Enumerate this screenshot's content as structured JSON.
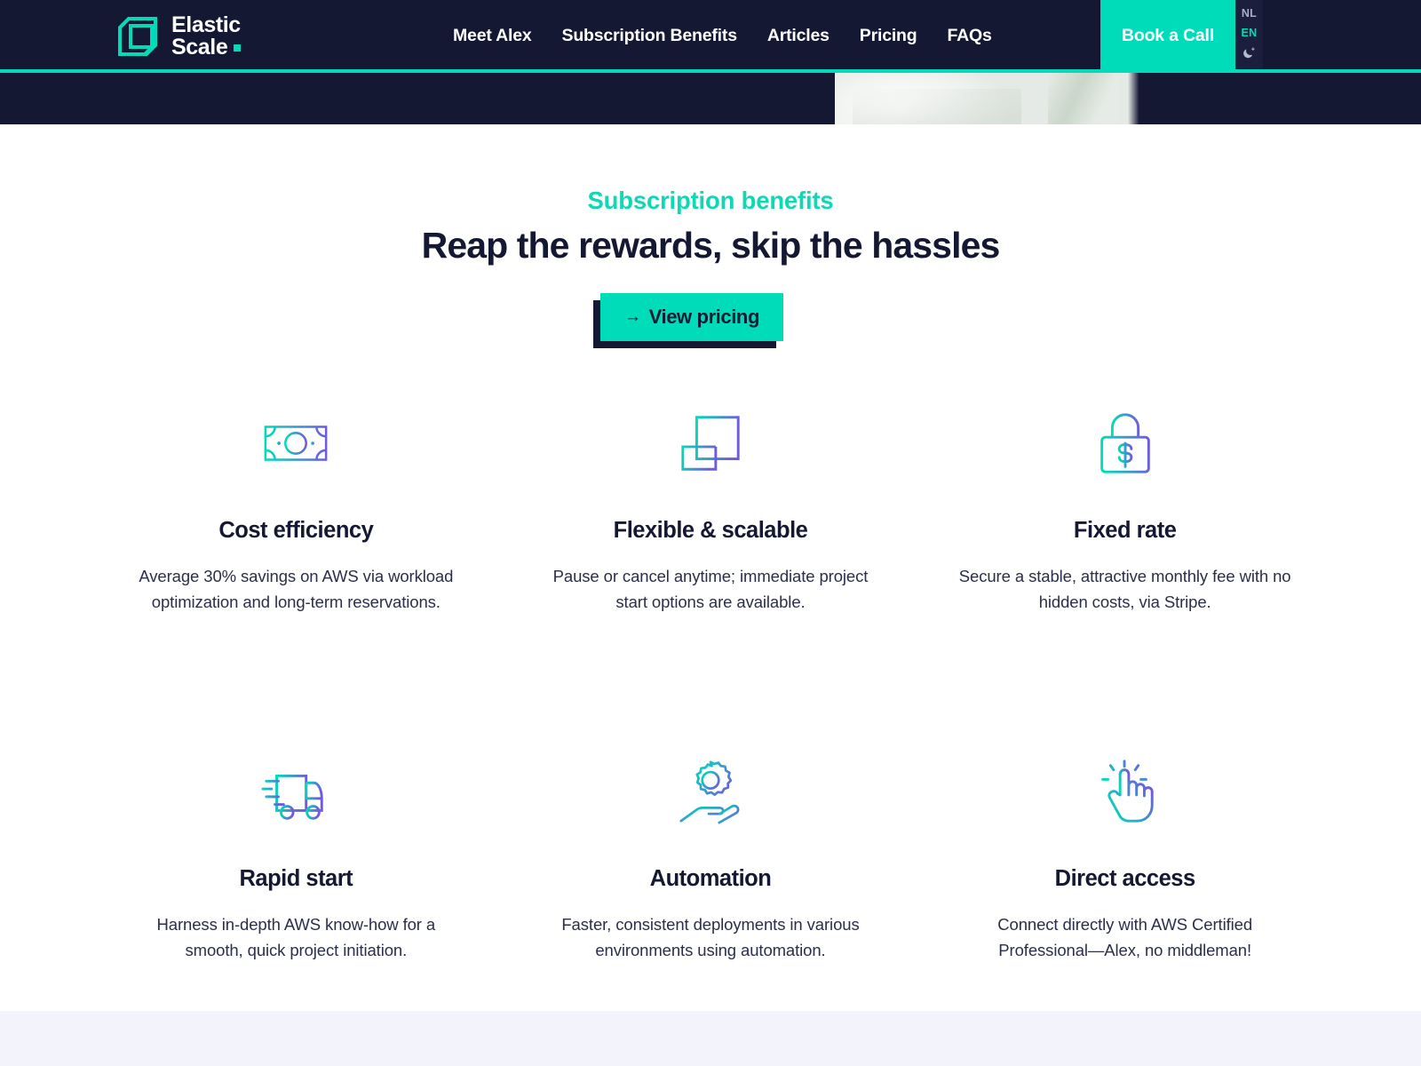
{
  "header": {
    "logo": {
      "mark_icon": "elastic-scale-cube-icon",
      "line1": "Elastic",
      "line2": "Scale",
      "dot": ""
    },
    "nav_items": [
      {
        "label": "Meet Alex"
      },
      {
        "label": "Subscription Benefits"
      },
      {
        "label": "Articles"
      },
      {
        "label": "Pricing"
      },
      {
        "label": "FAQs"
      }
    ],
    "cta_label": "Book a Call",
    "languages": [
      {
        "code": "NL",
        "active": false
      },
      {
        "code": "EN",
        "active": true
      }
    ],
    "theme_toggle_icon": "moon-star-icon",
    "colors": {
      "background": "#151833",
      "accent": "#00dcb9",
      "util_panel": "#1b1e3c",
      "lang_inactive": "#a9adc4"
    }
  },
  "main": {
    "eyebrow": "Subscription benefits",
    "title": "Reap the rewards, skip the hassles",
    "cta": {
      "label": "View pricing",
      "arrow_glyph": "→"
    },
    "benefits": [
      {
        "icon": "banknote-money-icon",
        "title": "Cost efficiency",
        "description": "Average 30% savings on AWS via workload optimization and long-term reservations."
      },
      {
        "icon": "resize-squares-icon",
        "title": "Flexible & scalable",
        "description": "Pause or cancel anytime; immediate project start options are available."
      },
      {
        "icon": "lock-dollar-icon",
        "title": "Fixed rate",
        "description": "Secure a stable, attractive monthly fee with no hidden costs, via Stripe."
      },
      {
        "icon": "fast-truck-icon",
        "title": "Rapid start",
        "description": "Harness in-depth AWS know-how for a smooth, quick project initiation."
      },
      {
        "icon": "gear-in-hand-icon",
        "title": "Automation",
        "description": "Faster, consistent deployments in various environments using automation."
      },
      {
        "icon": "tap-hand-icon",
        "title": "Direct access",
        "description": "Connect directly with AWS Certified Professional—Alex, no middleman!"
      }
    ],
    "colors": {
      "eyebrow": "#0fd9b4",
      "title": "#151833",
      "body_text": "#2b2f4a",
      "icon_gradient_start": "#00dcb9",
      "icon_gradient_end": "#6f5ae0",
      "footer_band": "#f3f3fb"
    }
  }
}
